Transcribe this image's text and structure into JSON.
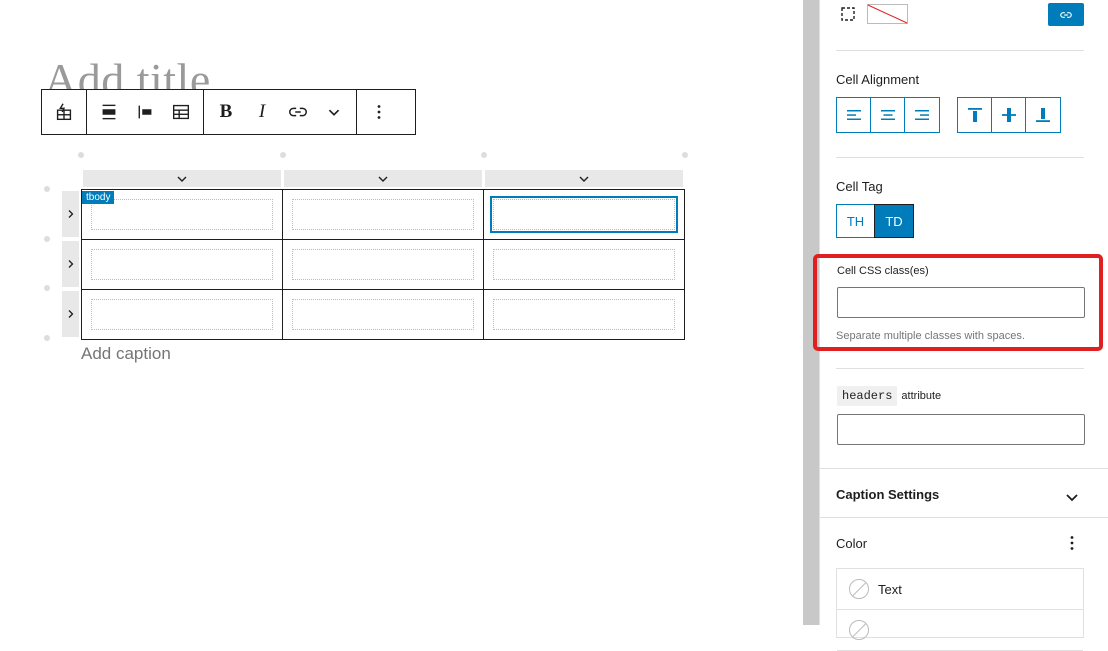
{
  "editor": {
    "title_placeholder": "Add title",
    "caption_placeholder": "Add caption",
    "tbody_label": "tbody"
  },
  "toolbar": {
    "bold_label": "B",
    "italic_label": "I"
  },
  "sidebar": {
    "cell_alignment_label": "Cell Alignment",
    "cell_tag_label": "Cell Tag",
    "tag_th": "TH",
    "tag_td": "TD",
    "css_class_label": "Cell CSS class(es)",
    "css_class_value": "",
    "css_class_help": "Separate multiple classes with spaces.",
    "headers_code": "headers",
    "headers_label": "attribute",
    "headers_value": "",
    "caption_settings_label": "Caption Settings",
    "color_label": "Color",
    "color_items": [
      "Text"
    ]
  },
  "colors": {
    "accent": "#007cba",
    "highlight": "#e02020"
  }
}
